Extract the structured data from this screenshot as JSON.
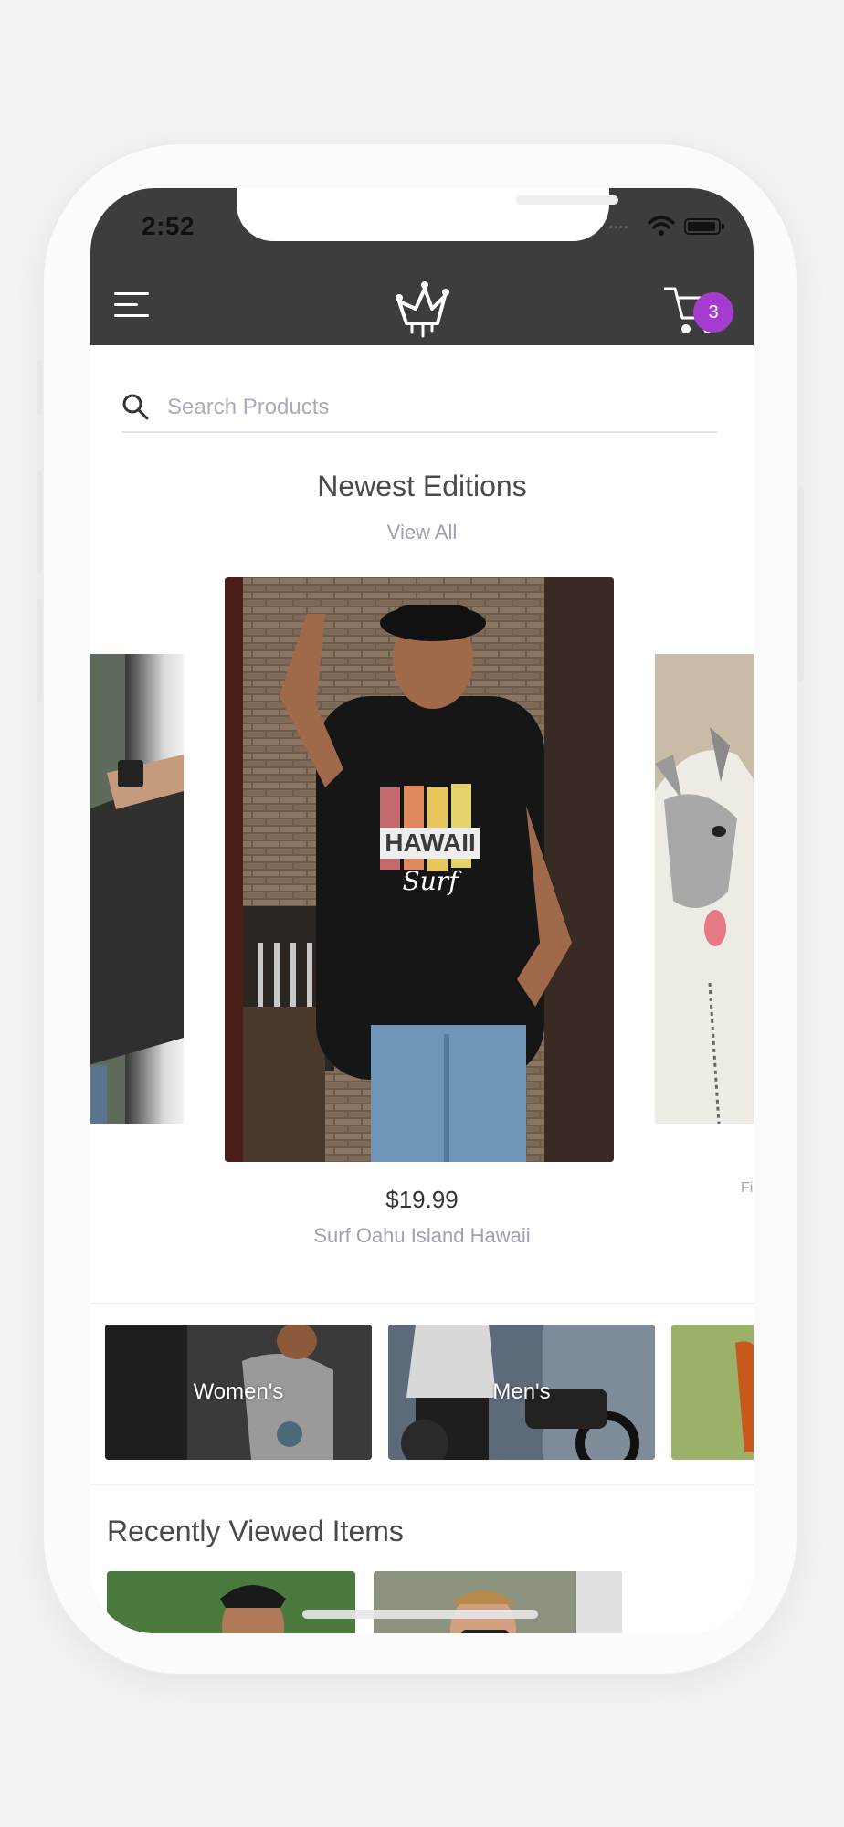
{
  "status_bar": {
    "time": "2:52"
  },
  "header": {
    "cart_count": "3",
    "brand_color": "#a63ccf",
    "bar_color": "#3d3d3d"
  },
  "search": {
    "placeholder": "Search Products"
  },
  "newest": {
    "title": "Newest Editions",
    "view_all": "View All",
    "featured": {
      "price": "$19.99",
      "name": "Surf Oahu Island Hawaii",
      "shirt_print": "HAWAII",
      "shirt_script": "Surf"
    },
    "peek_right_label": "Fi"
  },
  "categories": [
    {
      "label": "Women's"
    },
    {
      "label": "Men's"
    },
    {
      "label": ""
    }
  ],
  "recent": {
    "title": "Recently Viewed Items"
  }
}
